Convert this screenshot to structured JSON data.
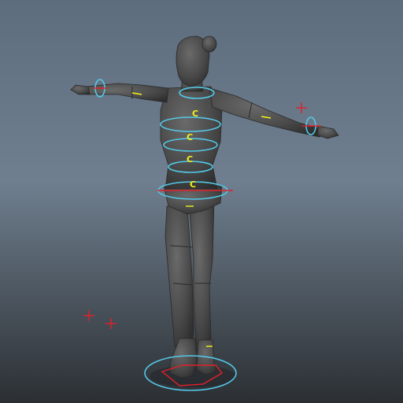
{
  "viewport": {
    "background_top": "#5d6d7d",
    "background_bottom": "#2b2f33"
  },
  "model": {
    "body_color": "#4a4a4a",
    "body_shade": "#2e2e2e",
    "body_highlight": "#6a6a6a"
  },
  "rig": {
    "control_color": "#53c8e6",
    "locator_color": "#e0202a",
    "pivot_color": "#f2f21a",
    "spine_labels": [
      "C",
      "C",
      "C",
      "C"
    ]
  }
}
